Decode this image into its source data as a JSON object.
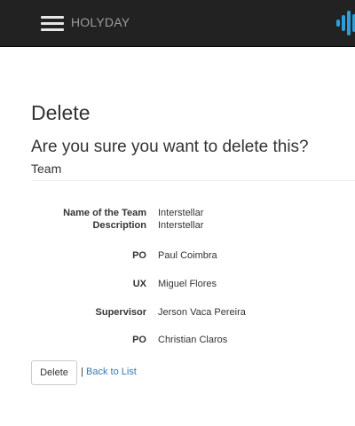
{
  "navbar": {
    "brand": "HOLYDAY"
  },
  "page": {
    "title": "Delete",
    "question": "Are you sure you want to delete this?",
    "entity": "Team"
  },
  "details": [
    {
      "label": "Name of the Team",
      "value": "Interstellar"
    },
    {
      "label": "Description",
      "value": "Interstellar"
    },
    {
      "label": "PO",
      "value": "Paul Coimbra"
    },
    {
      "label": "UX",
      "value": "Miguel Flores"
    },
    {
      "label": "Supervisor",
      "value": "Jerson Vaca Pereira"
    },
    {
      "label": "PO",
      "value": "Christian Claros"
    }
  ],
  "actions": {
    "delete_label": "Delete",
    "separator": "|",
    "back_label": "Back to List"
  },
  "colors": {
    "navbar_bg": "#222222",
    "brand_text": "#9d9d9d",
    "link": "#337ab7",
    "logo_blue": "#2a9fd8"
  },
  "icons": {
    "menu": "hamburger-menu-icon",
    "logo": "sound-wave-logo-icon"
  }
}
